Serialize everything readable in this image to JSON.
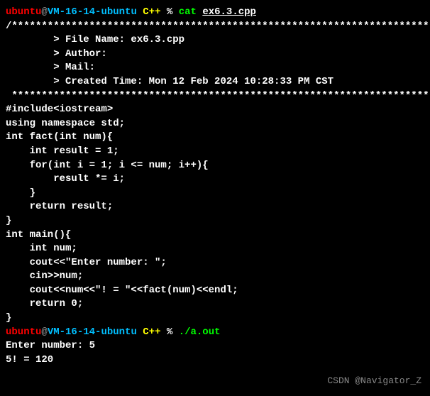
{
  "prompt1": {
    "user": "ubuntu",
    "at": "@",
    "host": "VM-16-14-ubuntu",
    "dir": "C++",
    "perc": "%",
    "cmd": "cat",
    "arg": "ex6.3.cpp"
  },
  "header": {
    "topBorder": "/*************************************************************************",
    "fileName": "        > File Name: ex6.3.cpp",
    "author": "        > Author:",
    "mail": "        > Mail:",
    "createdTime": "        > Created Time: Mon 12 Feb 2024 10:28:33 PM CST",
    "botBorder": " ************************************************************************/"
  },
  "code": {
    "l1": "",
    "l2": "#include<iostream>",
    "l3": "using namespace std;",
    "l4": "",
    "l5": "int fact(int num){",
    "l6": "    int result = 1;",
    "l7": "    for(int i = 1; i <= num; i++){",
    "l8": "        result *= i;",
    "l9": "    }",
    "l10": "    return result;",
    "l11": "}",
    "l12": "int main(){",
    "l13": "    int num;",
    "l14": "    cout<<\"Enter number: \";",
    "l15": "    cin>>num;",
    "l16": "    cout<<num<<\"! = \"<<fact(num)<<endl;",
    "l17": "",
    "l18": "    return 0;",
    "l19": "}"
  },
  "prompt2": {
    "user": "ubuntu",
    "at": "@",
    "host": "VM-16-14-ubuntu",
    "dir": "C++",
    "perc": "%",
    "cmd": "./a.out"
  },
  "output": {
    "l1": "Enter number: 5",
    "l2": "5! = 120"
  },
  "watermark": "CSDN @Navigator_Z"
}
